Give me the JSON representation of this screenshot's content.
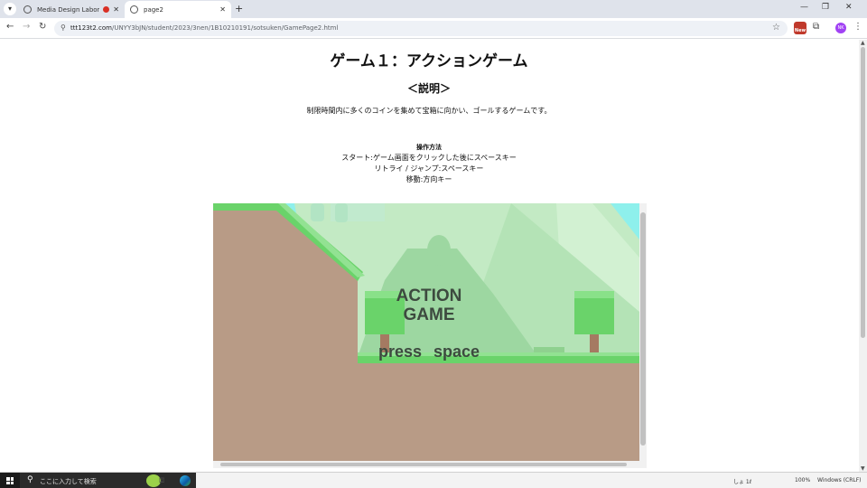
{
  "browser": {
    "tabs": [
      {
        "title": "Media Design Laboratory ...",
        "active": false,
        "recording": true
      },
      {
        "title": "page2",
        "active": true,
        "recording": false
      }
    ],
    "new_tab": "+",
    "url_host": "ttt123t2.com",
    "url_path": "/UNYY3bJN/student/2023/3nen/1B10210191/sotsuken/GamePage2.html",
    "extension_badge": "New",
    "avatar_initials": "NK"
  },
  "page": {
    "title": "ゲーム１：アクションゲーム",
    "section_heading": "＜説明＞",
    "description": "制限時間内に多くのコインを集めて宝箱に向かい、ゴールするゲームです。",
    "controls": {
      "title": "操作方法",
      "lines": [
        "スタート:ゲーム画面をクリックした後にスペースキー",
        "リトライ / ジャンプ:スペースキー",
        "移動:方向キー"
      ]
    }
  },
  "game": {
    "title_line1": "ACTION",
    "title_line2": "GAME",
    "prompt": "press space",
    "colors": {
      "sky": "#8ef0ec",
      "mountain_light": "#b9e6bd",
      "grass": "#6ad36a",
      "dirt": "#b89b86",
      "text": "#3d4a3f"
    }
  },
  "taskbar": {
    "search_placeholder": "ここに入力して検索",
    "tray_ime": "しょ 1ℓ",
    "tray_zoom": "100%",
    "tray_status": "Windows (CRLF)"
  }
}
